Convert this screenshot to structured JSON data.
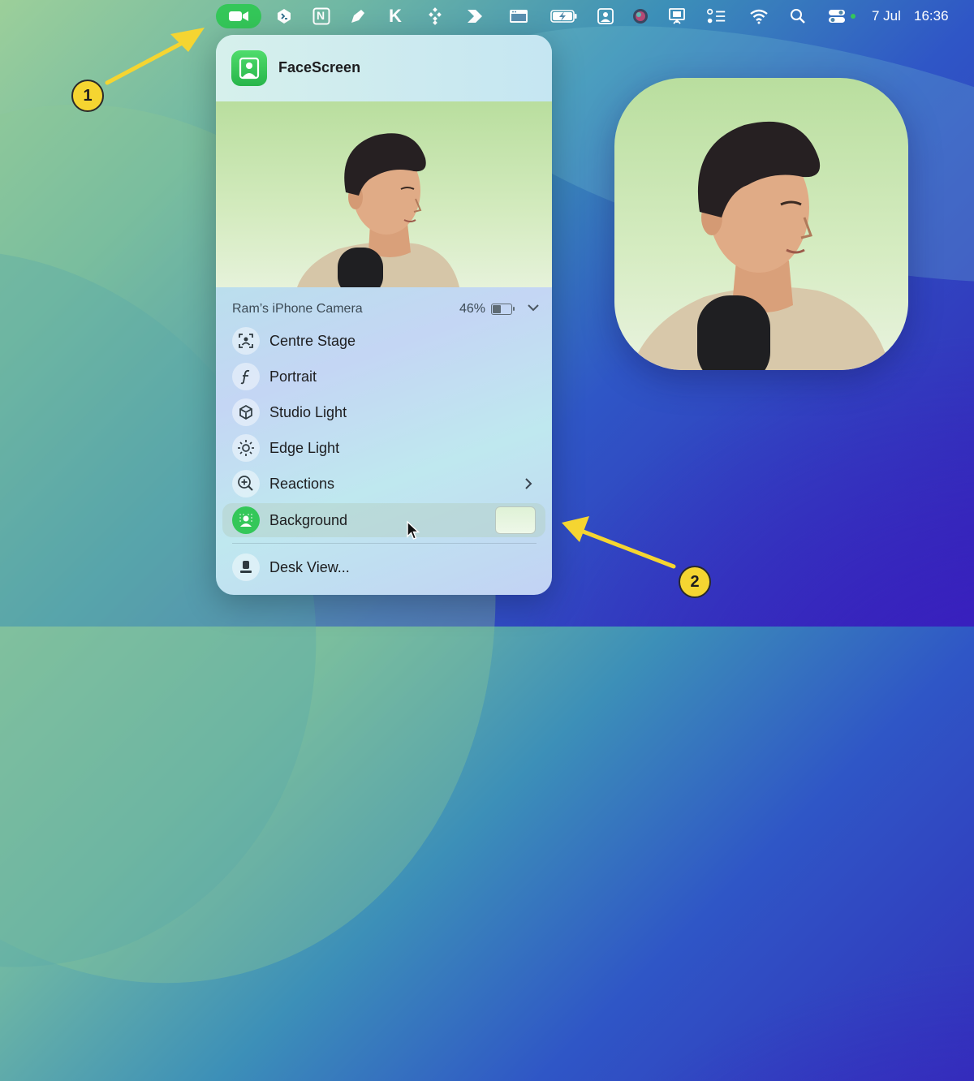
{
  "menubar": {
    "icons": [
      "video-camera-icon",
      "terminal-icon",
      "notion-icon",
      "pen-icon",
      "k-icon",
      "diamond-grid-icon",
      "arrow-icon",
      "window-icon",
      "battery-charging-icon",
      "contact-card-icon",
      "siri-icon",
      "presentation-icon",
      "control-list-icon",
      "wifi-icon",
      "search-icon",
      "control-center-icon"
    ],
    "k_letter": "K",
    "n_letter": "N",
    "date": "7 Jul",
    "time": "16:36"
  },
  "popover": {
    "app_title": "FaceScreen",
    "device_name": "Ram’s iPhone Camera",
    "battery_percent": "46%",
    "battery_level": 0.46,
    "items": [
      {
        "label": "Centre Stage",
        "icon": "centre-stage-icon"
      },
      {
        "label": "Portrait",
        "icon": "portrait-f-icon"
      },
      {
        "label": "Studio Light",
        "icon": "cube-icon"
      },
      {
        "label": "Edge Light",
        "icon": "sun-icon"
      },
      {
        "label": "Reactions",
        "icon": "reactions-icon"
      },
      {
        "label": "Background",
        "icon": "background-person-icon"
      },
      {
        "label": "Desk View...",
        "icon": "desk-view-icon"
      }
    ],
    "background_swatch_color": "#dff2d6"
  },
  "callouts": {
    "one": "1",
    "two": "2",
    "color": "#f5d531"
  },
  "colors": {
    "accent_green": "#34c759",
    "arrow_yellow": "#f5d531"
  }
}
